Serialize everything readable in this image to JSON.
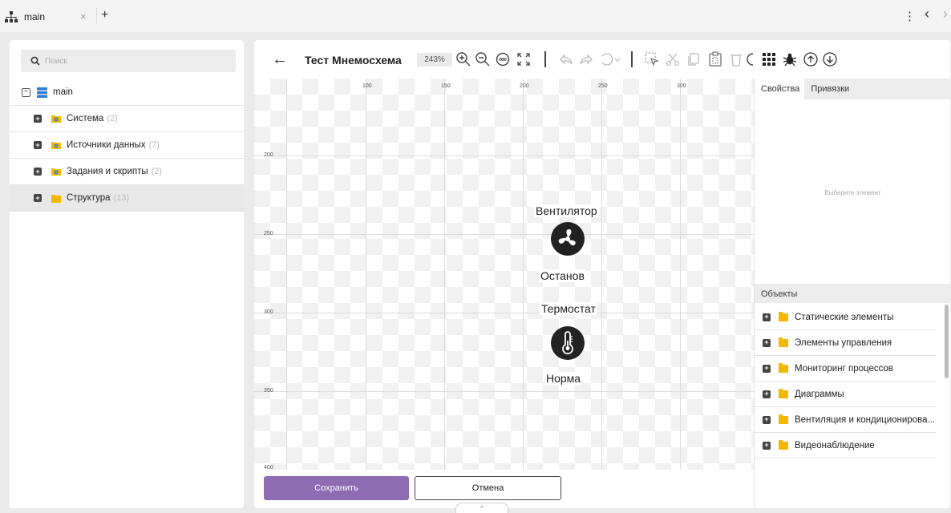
{
  "tabbar": {
    "tab_label": "main",
    "close": "×",
    "new_tab": "+",
    "menu": "⋮",
    "nav_left": "‹",
    "nav_right": "›"
  },
  "sidebar": {
    "search_placeholder": "Поиск",
    "root_label": "main",
    "items": [
      {
        "label": "Система",
        "count": "(2)",
        "icon": "gear-folder-icon"
      },
      {
        "label": "Источники данных",
        "count": "(7)",
        "icon": "gear-folder-icon"
      },
      {
        "label": "Задания и скрипты",
        "count": "(2)",
        "icon": "gear-folder-icon"
      },
      {
        "label": "Структура",
        "count": "(13)",
        "icon": "folder-icon"
      }
    ]
  },
  "editor": {
    "title": "Тест Мнемосхема",
    "zoom": "243%"
  },
  "canvas": {
    "ruler_x": [
      "100",
      "150",
      "200",
      "250",
      "300"
    ],
    "ruler_y": [
      "200",
      "250",
      "300",
      "350",
      "400"
    ],
    "elements": [
      {
        "title": "Вентилятор",
        "icon": "fan-icon",
        "status": "Останов"
      },
      {
        "title": "Термостат",
        "icon": "thermometer-icon",
        "status": "Норма"
      }
    ]
  },
  "properties": {
    "tab_properties": "Свойства",
    "tab_bindings": "Привязки",
    "empty_text": "Выберите элемент"
  },
  "objects": {
    "header": "Объекты",
    "items": [
      "Статические элементы",
      "Элементы управления",
      "Мониторинг процессов",
      "Диаграммы",
      "Вентиляция и кондиционирова...",
      "Видеонаблюдение"
    ]
  },
  "footer": {
    "save_label": "Сохранить",
    "cancel_label": "Отмена",
    "collapse": "^"
  },
  "colors": {
    "accent": "#8e6bb3",
    "folder": "#f5b700",
    "db_icon": "#2f7bd8"
  }
}
